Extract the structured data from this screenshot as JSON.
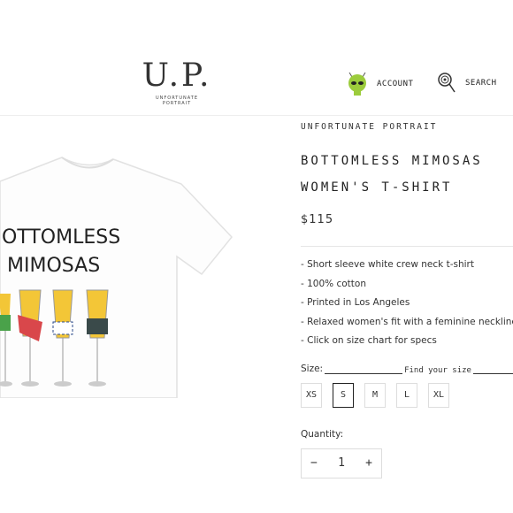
{
  "header": {
    "logo_mark": "U.P.",
    "logo_sub": "UNFORTUNATE PORTRAIT",
    "account_label": "ACCOUNT",
    "search_label": "SEARCH"
  },
  "product": {
    "shirt_text_line1": "OTTOMLESS",
    "shirt_text_line2": "MIMOSAS",
    "vendor": "UNFORTUNATE PORTRAIT",
    "title_line1": "BOTTOMLESS MIMOSAS",
    "title_line2": "WOMEN'S T-SHIRT",
    "price": "$115",
    "features": [
      "- Short sleeve white crew neck t-shirt",
      "- 100% cotton",
      "- Printed in Los Angeles",
      "- Relaxed women's fit with a feminine neckline",
      "- Click on size chart for specs"
    ],
    "size_label": "Size:",
    "find_size": "Find your size",
    "sizes": [
      "XS",
      "S",
      "M",
      "L",
      "XL"
    ],
    "selected_size": "S",
    "quantity_label": "Quantity:",
    "quantity": "1",
    "minus": "−",
    "plus": "+"
  },
  "colors": {
    "accent": "#222222",
    "alien": "#9ccc3c"
  },
  "icons": {
    "account": "alien-icon",
    "search": "lollipop-icon"
  }
}
